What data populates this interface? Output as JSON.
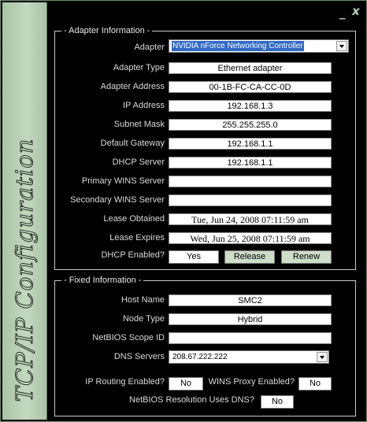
{
  "window": {
    "side_title": "TCP/IP Configuration",
    "minimize_glyph": "_",
    "close_glyph": "x"
  },
  "adapter": {
    "group_title": "- Adapter Information -",
    "labels": {
      "adapter": "Adapter",
      "adapter_type": "Adapter Type",
      "adapter_address": "Adapter Address",
      "ip_address": "IP Address",
      "subnet_mask": "Subnet Mask",
      "default_gateway": "Default Gateway",
      "dhcp_server": "DHCP Server",
      "primary_wins": "Primary WINS Server",
      "secondary_wins": "Secondary WINS Server",
      "lease_obtained": "Lease Obtained",
      "lease_expires": "Lease Expires",
      "dhcp_enabled": "DHCP Enabled?"
    },
    "values": {
      "adapter": "NVIDIA nForce Networking Controller",
      "adapter_type": "Ethernet adapter",
      "adapter_address": "00-1B-FC-CA-CC-0D",
      "ip_address": "192.168.1.3",
      "subnet_mask": "255.255.255.0",
      "default_gateway": "192.168.1.1",
      "dhcp_server": "192.168.1.1",
      "primary_wins": "",
      "secondary_wins": "",
      "lease_obtained": "Tue, Jun 24, 2008 07:11:59 am",
      "lease_expires": "Wed, Jun 25, 2008 07:11:59 am",
      "dhcp_enabled": "Yes"
    },
    "buttons": {
      "release": "Release",
      "renew": "Renew"
    }
  },
  "fixed": {
    "group_title": "- Fixed Information -",
    "labels": {
      "host_name": "Host Name",
      "node_type": "Node Type",
      "netbios_scope": "NetBIOS Scope ID",
      "dns_servers": "DNS Servers",
      "ip_routing": "IP Routing Enabled?",
      "wins_proxy": "WINS Proxy Enabled?",
      "netbios_dns": "NetBIOS Resolution Uses DNS?"
    },
    "values": {
      "host_name": "SMC2",
      "node_type": "Hybrid",
      "netbios_scope": "",
      "dns_servers": "208.67.222.222",
      "ip_routing": "No",
      "wins_proxy": "No",
      "netbios_dns": "No"
    }
  }
}
